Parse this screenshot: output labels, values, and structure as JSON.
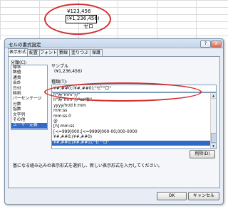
{
  "sheet": {
    "cell1": "¥123,456",
    "cell2": "(¥1,236,456)",
    "cell3": "ゼロ"
  },
  "dialog": {
    "title": "セルの書式設定",
    "help_label": "?",
    "close_label": "X",
    "tabs": [
      "表示形式",
      "配置",
      "フォント",
      "罫線",
      "塗りつぶし",
      "保護"
    ],
    "category_label": "分類(C):",
    "categories": [
      "標準",
      "数値",
      "通貨",
      "会計",
      "日付",
      "時刻",
      "パーセンテージ",
      "分数",
      "指数",
      "文字列",
      "その他",
      "ユーザー定義"
    ],
    "selected_category_index": 11,
    "sample_label": "サンプル",
    "sample_value": "(¥1,236,456)",
    "type_label": "種類(T):",
    "type_value": "¥#,##0;(¥#,##0);\"ゼ\"\"ロ\"",
    "formats": [
      "h\"時\"mm\"分\"",
      "h\"時\"mm\"分\"ss\"秒\"",
      "yyyy/m/d h:mm",
      "mm:ss",
      "mm:ss.0",
      "@",
      "[h]:mm:ss",
      "[<=999]000;[<=9999]000-00;000-0000",
      "¥#,##0;(¥#,##0)",
      "¥#,##0;(¥#,##0);\"ゼ\"\"ロ\""
    ],
    "selected_format_index": 9,
    "delete_label": "削除(D)",
    "description": "基になる組み込みの表示形式を選択し、新しい表示形式を入力してください。",
    "ok_label": "OK",
    "cancel_label": "キャンセル"
  },
  "colors": {
    "highlight_oval": "#d03030",
    "selection": "#3169c6"
  }
}
